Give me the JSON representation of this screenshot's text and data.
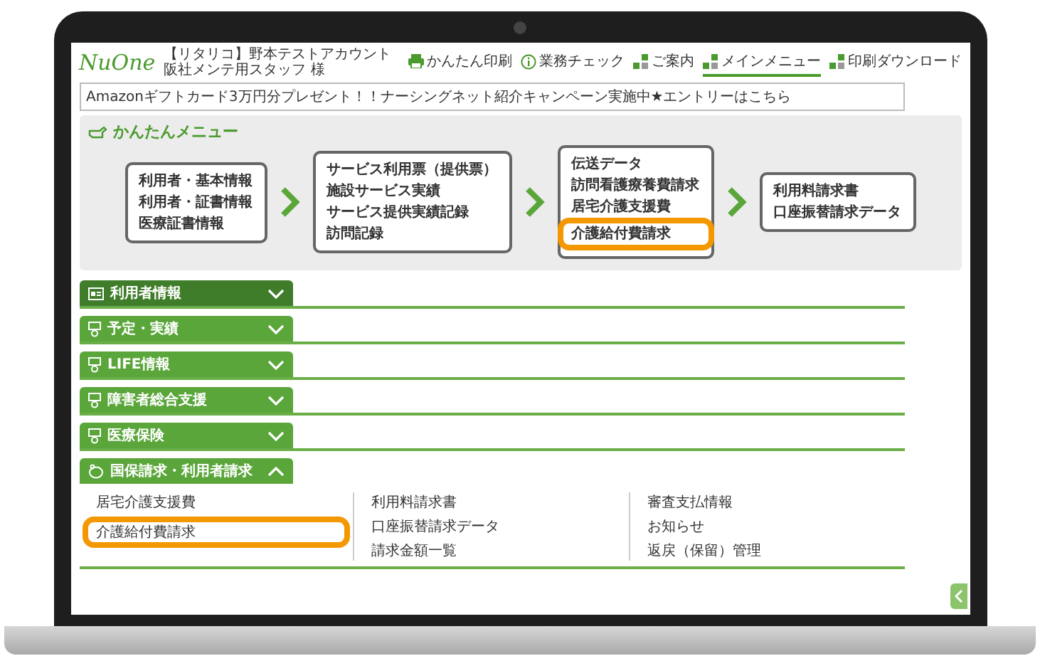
{
  "header": {
    "logo": "NuOne",
    "account": "【リタリコ】野本テストアカウント",
    "staff": "阪社メンテ用スタッフ 様",
    "nav": [
      {
        "label": "かんたん印刷",
        "kind": "printer",
        "selected": false
      },
      {
        "label": "業務チェック",
        "kind": "info",
        "selected": false
      },
      {
        "label": "ご案内",
        "kind": "tiles",
        "selected": false
      },
      {
        "label": "メインメニュー",
        "kind": "tiles",
        "selected": true
      },
      {
        "label": "印刷ダウンロード",
        "kind": "tiles",
        "selected": false
      }
    ]
  },
  "banner": "Amazonギフトカード3万円分プレゼント！！ナーシングネット紹介キャンペーン実施中★エントリーはこちら",
  "quick_menu": {
    "title": "かんたんメニュー",
    "steps": [
      {
        "items": [
          {
            "label": "利用者・基本情報",
            "highlighted": false
          },
          {
            "label": "利用者・証書情報",
            "highlighted": false
          },
          {
            "label": "医療証書情報",
            "highlighted": false
          }
        ]
      },
      {
        "items": [
          {
            "label": "サービス利用票（提供票）",
            "highlighted": false
          },
          {
            "label": "施設サービス実績",
            "highlighted": false
          },
          {
            "label": "サービス提供実績記録",
            "highlighted": false
          },
          {
            "label": "訪問記録",
            "highlighted": false
          }
        ]
      },
      {
        "items": [
          {
            "label": "伝送データ",
            "highlighted": false
          },
          {
            "label": "訪問看護療養費請求",
            "highlighted": false
          },
          {
            "label": "居宅介護支援費",
            "highlighted": false
          },
          {
            "label": "介護給付費請求",
            "highlighted": true
          }
        ]
      },
      {
        "items": [
          {
            "label": "利用料請求書",
            "highlighted": false
          },
          {
            "label": "口座振替請求データ",
            "highlighted": false
          }
        ]
      }
    ]
  },
  "sections": [
    {
      "label": "利用者情報",
      "kind": "id-card",
      "selected": true,
      "expanded": false
    },
    {
      "label": "予定・実績",
      "kind": "phone",
      "selected": false,
      "expanded": false
    },
    {
      "label": "LIFE情報",
      "kind": "phone",
      "selected": false,
      "expanded": false
    },
    {
      "label": "障害者総合支援",
      "kind": "phone",
      "selected": false,
      "expanded": false
    },
    {
      "label": "医療保険",
      "kind": "phone",
      "selected": false,
      "expanded": false
    },
    {
      "label": "国保請求・利用者請求",
      "kind": "pig",
      "selected": false,
      "expanded": true,
      "columns": [
        [
          {
            "label": "居宅介護支援費",
            "highlighted": false
          },
          {
            "label": "介護給付費請求",
            "highlighted": true
          }
        ],
        [
          {
            "label": "利用料請求書",
            "highlighted": false
          },
          {
            "label": "口座振替請求データ",
            "highlighted": false
          },
          {
            "label": "請求金額一覧",
            "highlighted": false
          }
        ],
        [
          {
            "label": "審査支払情報",
            "highlighted": false
          },
          {
            "label": "お知らせ",
            "highlighted": false
          },
          {
            "label": "返戻（保留）管理",
            "highlighted": false
          }
        ]
      ]
    }
  ]
}
